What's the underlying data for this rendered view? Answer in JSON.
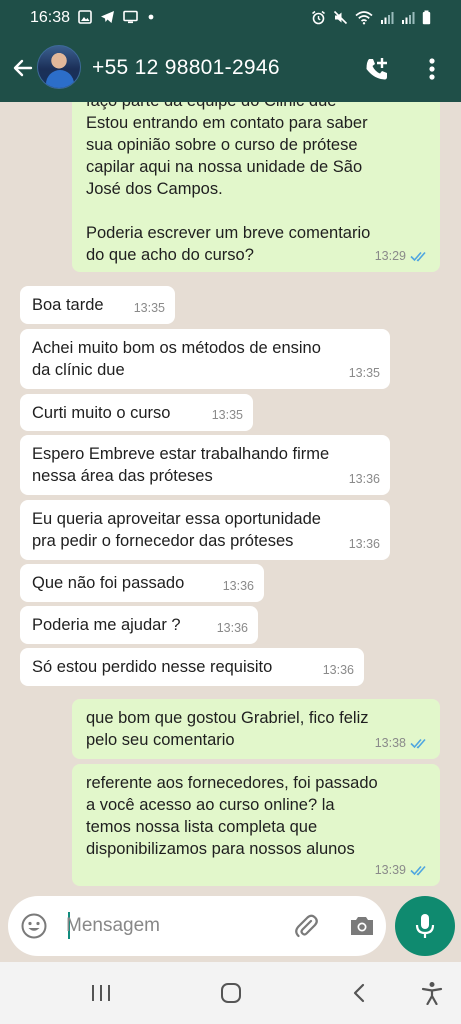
{
  "status_bar": {
    "time": "16:38",
    "left_icons": [
      "image-icon",
      "telegram-icon",
      "monitor-icon",
      "dot-icon"
    ],
    "right_icons": [
      "alarm-icon",
      "mute-icon",
      "wifi-icon",
      "signal-icon",
      "signal-icon",
      "battery-icon"
    ]
  },
  "header": {
    "contact_name": "+55 12 98801-2946",
    "icons": [
      "back-arrow-icon",
      "add-call-icon",
      "more-vert-icon"
    ]
  },
  "messages": [
    {
      "dir": "out",
      "text": "faço parte da equipe do Clinic due\nEstou entrando em contato para saber\nsua opinião sobre o curso de prótese\ncapilar aqui na nossa unidade de São\nJosé dos Campos.\n\nPoderia escrever um breve comentario\ndo que acho do curso?",
      "time": "13:29",
      "read": true
    },
    {
      "dir": "in",
      "text": "Boa tarde",
      "time": "13:35"
    },
    {
      "dir": "in",
      "text": "Achei muito bom os métodos de ensino\nda clínic due",
      "time": "13:35"
    },
    {
      "dir": "in",
      "text": "Curti muito o curso",
      "time": "13:35"
    },
    {
      "dir": "in",
      "text": "Espero Embreve estar trabalhando firme\nnessa área das próteses",
      "time": "13:36"
    },
    {
      "dir": "in",
      "text": "Eu queria aproveitar essa oportunidade\npra pedir o fornecedor das próteses",
      "time": "13:36"
    },
    {
      "dir": "in",
      "text": "Que não foi passado",
      "time": "13:36"
    },
    {
      "dir": "in",
      "text": "Poderia me ajudar ?",
      "time": "13:36"
    },
    {
      "dir": "in",
      "text": "Só estou perdido nesse requisito",
      "time": "13:36"
    },
    {
      "dir": "out",
      "text": "que bom que gostou Grabriel, fico feliz\npelo seu comentario",
      "time": "13:38",
      "read": true
    },
    {
      "dir": "out",
      "text": "referente aos fornecedores, foi passado\na você acesso ao curso online? la\ntemos nossa lista completa que\ndisponibilizamos para nossos alunos",
      "time": "13:39",
      "read": true
    }
  ],
  "input": {
    "placeholder": "Mensagem",
    "icons": [
      "emoji-icon",
      "attach-icon",
      "camera-icon",
      "mic-icon"
    ]
  },
  "nav_bar": {
    "icons": [
      "recents-icon",
      "home-icon",
      "back-icon",
      "accessibility-icon"
    ]
  },
  "colors": {
    "header": "#1f4f48",
    "chat_bg": "#e6ddd4",
    "outgoing_bubble": "#e2f7cb",
    "incoming_bubble": "#ffffff",
    "read_ticks": "#4fa6e0",
    "mic_button": "#0f8a6f"
  }
}
